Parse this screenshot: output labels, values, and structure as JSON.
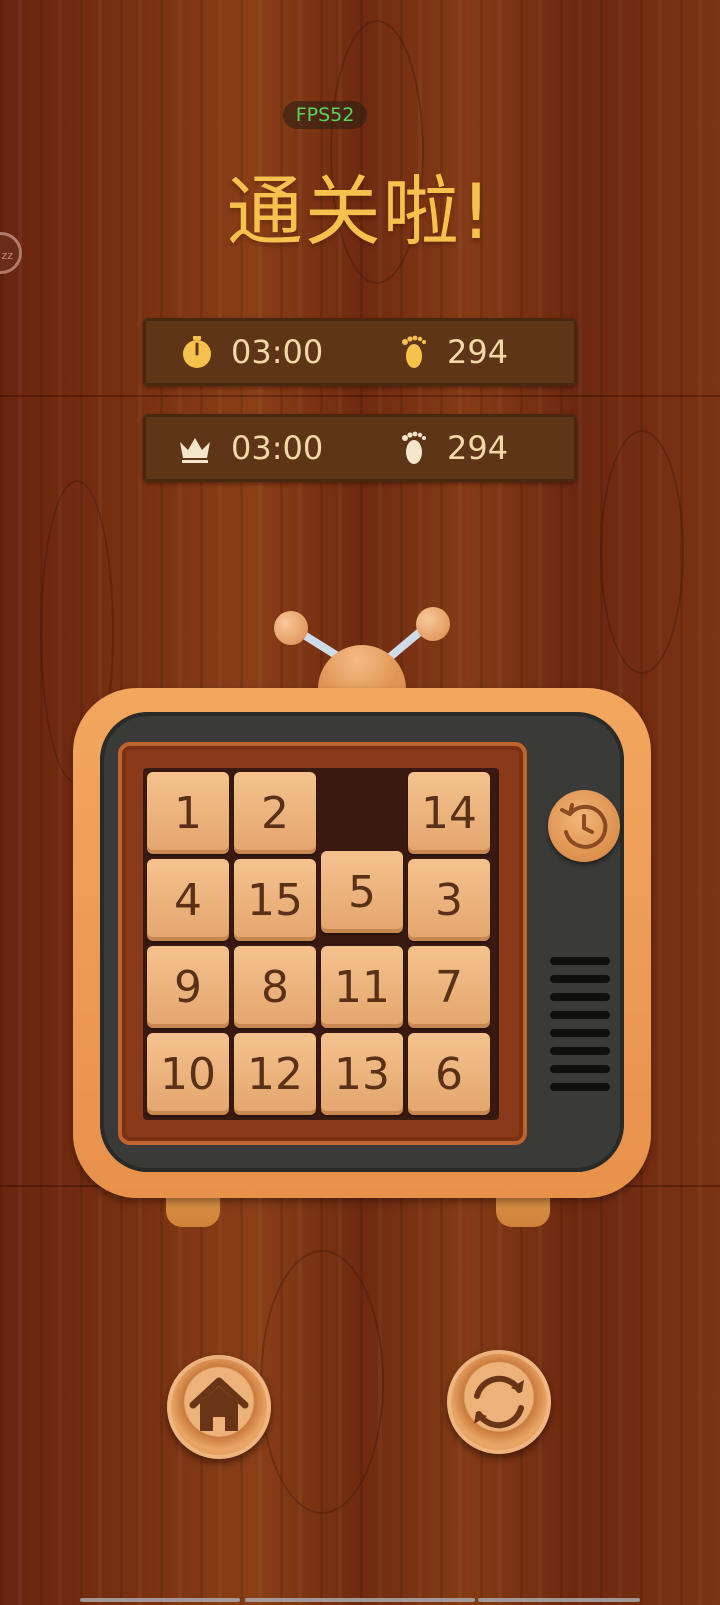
{
  "status": {
    "fps": "FPS52",
    "side_bubble": "zz"
  },
  "title": "通关啦!",
  "current": {
    "time": "03:00",
    "steps": "294",
    "time_icon": "stopwatch-icon",
    "steps_icon": "footprint-icon"
  },
  "best": {
    "time": "03:00",
    "steps": "294",
    "time_icon": "crown-icon",
    "steps_icon": "footprint-icon"
  },
  "board": {
    "tiles": [
      {
        "row": 0,
        "col": 0,
        "label": "1"
      },
      {
        "row": 0,
        "col": 1,
        "label": "2"
      },
      {
        "row": 0,
        "col": 3,
        "label": "14"
      },
      {
        "row": 1,
        "col": 0,
        "label": "4"
      },
      {
        "row": 1,
        "col": 1,
        "label": "15"
      },
      {
        "row": 1,
        "col": 2,
        "label": "5"
      },
      {
        "row": 1,
        "col": 3,
        "label": "3"
      },
      {
        "row": 2,
        "col": 0,
        "label": "9"
      },
      {
        "row": 2,
        "col": 1,
        "label": "8"
      },
      {
        "row": 2,
        "col": 2,
        "label": "11"
      },
      {
        "row": 2,
        "col": 3,
        "label": "7"
      },
      {
        "row": 3,
        "col": 0,
        "label": "10"
      },
      {
        "row": 3,
        "col": 1,
        "label": "12"
      },
      {
        "row": 3,
        "col": 2,
        "label": "13"
      },
      {
        "row": 3,
        "col": 3,
        "label": "6"
      }
    ],
    "empty": {
      "row": 0,
      "col": 2
    }
  },
  "buttons": {
    "history": "history-icon",
    "home": "home-icon",
    "restart": "restart-icon"
  },
  "colors": {
    "title": "#f6c24d",
    "fps": "#5bd35b",
    "stat_text": "#f3d9a8",
    "tile": "#e9b07b",
    "tile_text": "#5a3017"
  }
}
